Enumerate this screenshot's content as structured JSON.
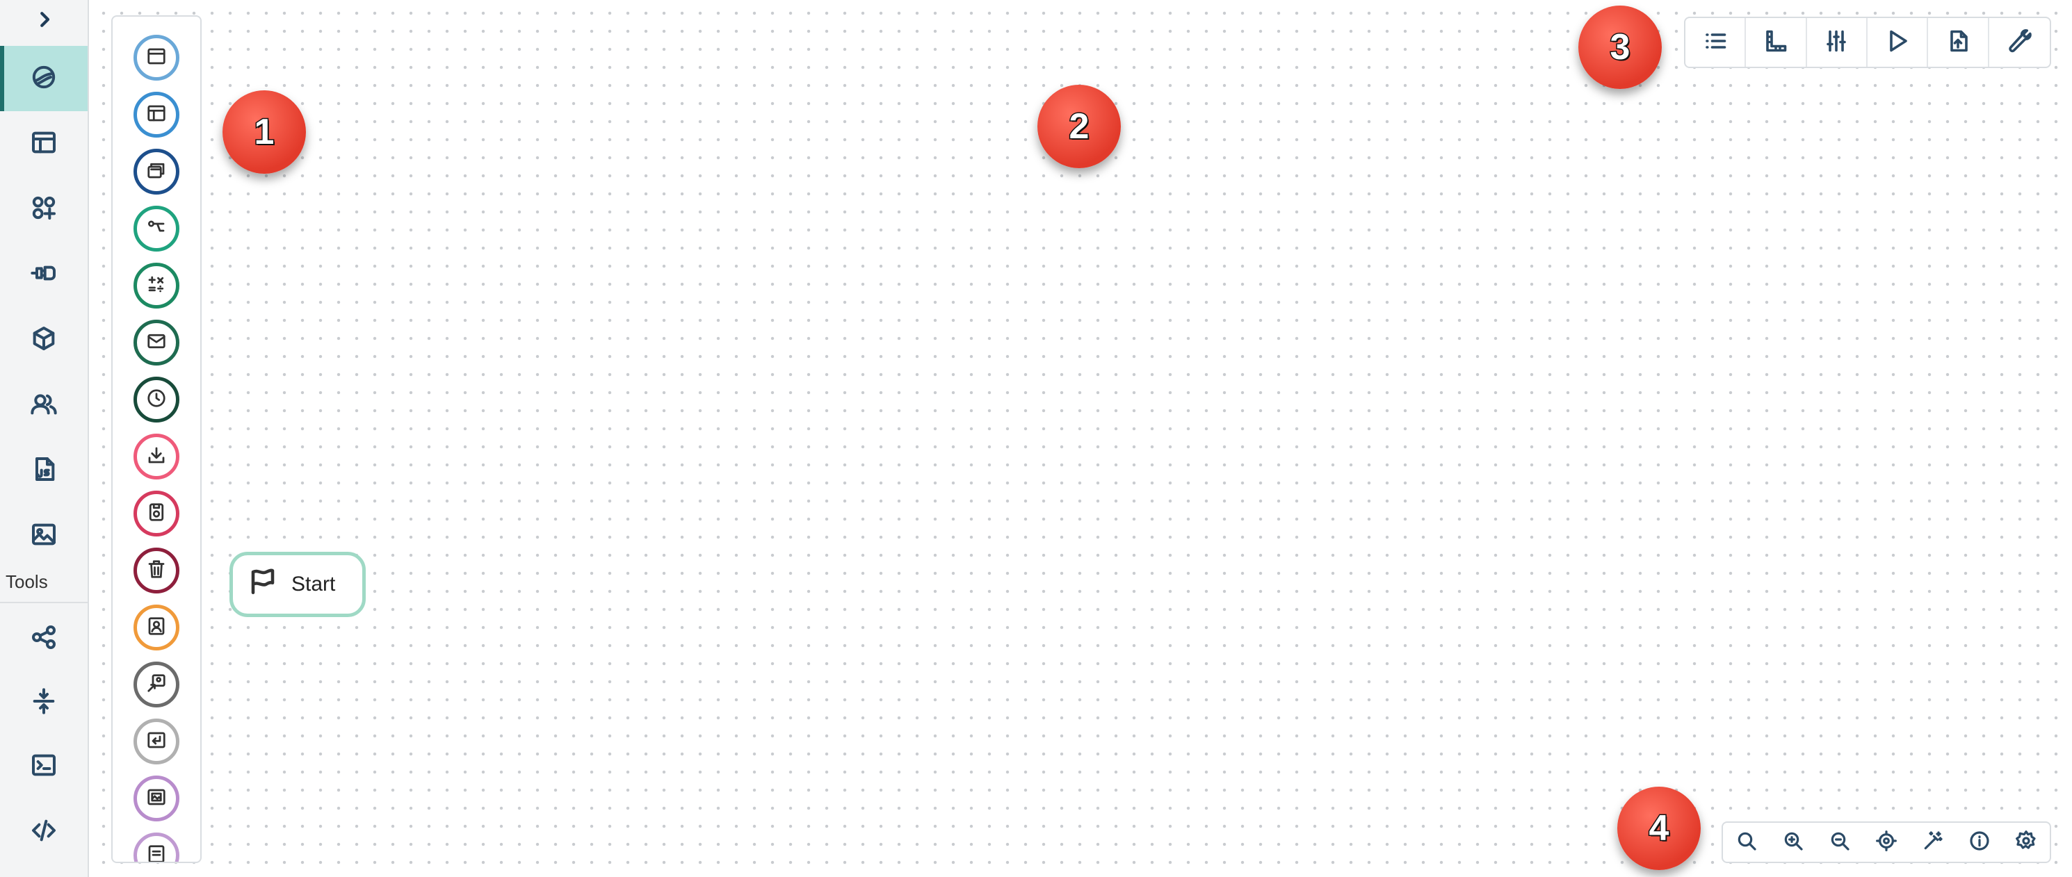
{
  "rail": {
    "tools_label": "Tools",
    "items": [
      {
        "icon": "expand-chevron-icon"
      },
      {
        "icon": "process-designer-icon",
        "active": true
      },
      {
        "icon": "layout-icon"
      },
      {
        "icon": "components-icon"
      },
      {
        "icon": "plugin-icon"
      },
      {
        "icon": "package-icon"
      },
      {
        "icon": "users-icon"
      },
      {
        "icon": "js-file-icon"
      },
      {
        "icon": "image-icon"
      },
      {
        "icon": "share-icon"
      },
      {
        "icon": "compress-icon"
      },
      {
        "icon": "terminal-icon"
      },
      {
        "icon": "code-icon"
      }
    ]
  },
  "palette": {
    "items": [
      {
        "name": "window-element",
        "color": "#6aa8d8"
      },
      {
        "name": "layout-element",
        "color": "#3a8fd1"
      },
      {
        "name": "cards-element",
        "color": "#1d4f8c"
      },
      {
        "name": "branch-element",
        "color": "#1fa37f"
      },
      {
        "name": "calculate-element",
        "color": "#1c8a62"
      },
      {
        "name": "email-element",
        "color": "#1e6b50"
      },
      {
        "name": "timer-element",
        "color": "#184b3a"
      },
      {
        "name": "download-element",
        "color": "#ef5a7a"
      },
      {
        "name": "save-element",
        "color": "#d63a5e"
      },
      {
        "name": "delete-element",
        "color": "#8e1f3c"
      },
      {
        "name": "contact-element",
        "color": "#f09a3a"
      },
      {
        "name": "user-task-element",
        "color": "#6b6b6b"
      },
      {
        "name": "return-element",
        "color": "#b0b0b0"
      },
      {
        "name": "gallery-element",
        "color": "#b88ccc"
      },
      {
        "name": "document-element",
        "color": "#c09ad2"
      }
    ]
  },
  "start_node": {
    "label": "Start"
  },
  "top_toolbar": {
    "buttons": [
      "list-icon",
      "ruler-icon",
      "sliders-icon",
      "play-icon",
      "export-icon",
      "wrench-icon"
    ]
  },
  "bottom_toolbar": {
    "buttons": [
      "search-icon",
      "zoom-in-icon",
      "zoom-out-icon",
      "locate-icon",
      "magic-wand-icon",
      "info-icon",
      "settings-icon"
    ]
  },
  "callouts": [
    "1",
    "2",
    "3",
    "4"
  ]
}
